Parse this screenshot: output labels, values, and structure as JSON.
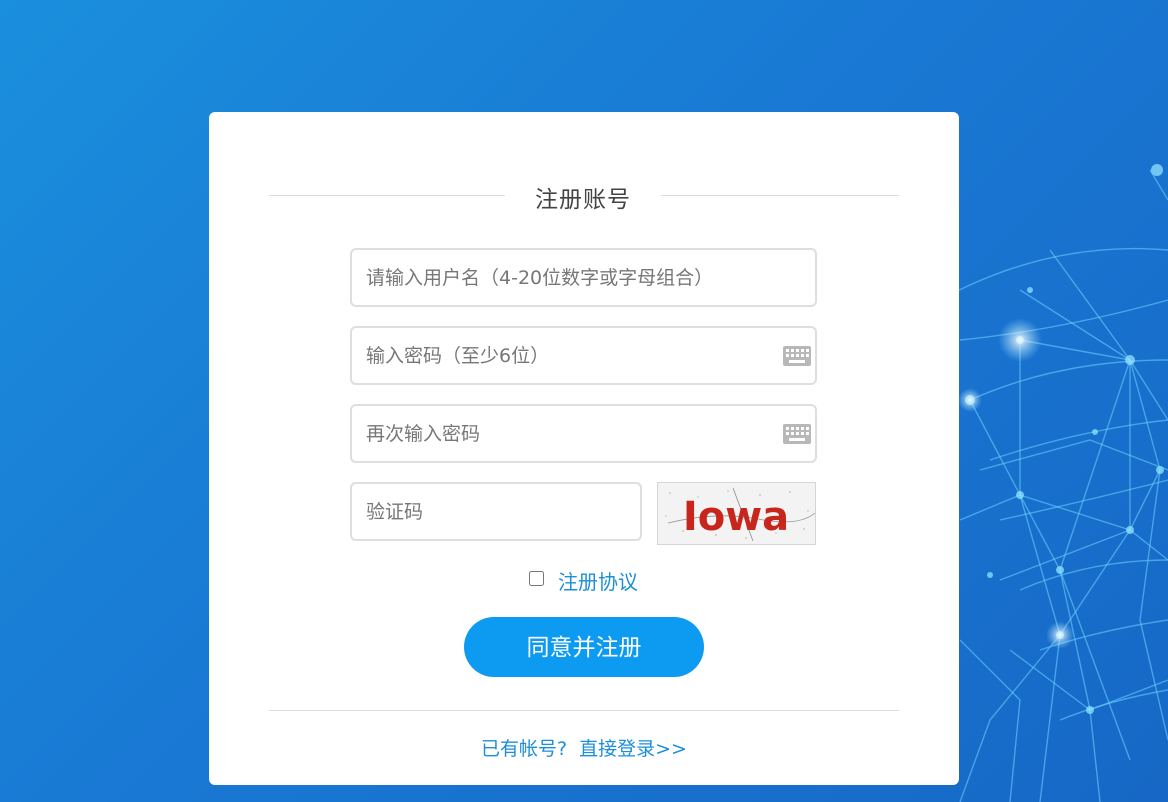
{
  "page": {
    "background_color": "#1979d4"
  },
  "form": {
    "title": "注册账号",
    "username": {
      "placeholder": "请输入用户名（4-20位数字或字母组合）",
      "value": ""
    },
    "password": {
      "placeholder": "输入密码（至少6位）",
      "value": ""
    },
    "password_confirm": {
      "placeholder": "再次输入密码",
      "value": ""
    },
    "captcha_input": {
      "placeholder": "验证码",
      "value": ""
    },
    "captcha_image_text": "Iowa",
    "agreement": {
      "label": "注册协议",
      "checked": false
    },
    "submit_label": "同意并注册",
    "login_prompt": "已有帐号?",
    "login_link": "直接登录>>",
    "icons": {
      "password_toggle": "keyboard-icon"
    },
    "colors": {
      "accent": "#0d9bf2",
      "link": "#1d8fd8",
      "captcha_text": "#c8261c"
    }
  }
}
